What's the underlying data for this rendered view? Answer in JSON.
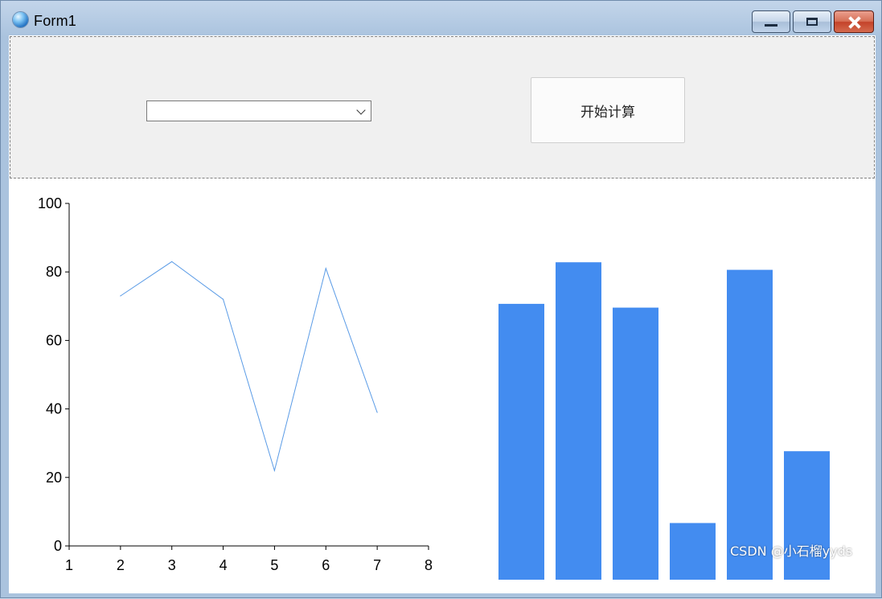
{
  "window": {
    "title": "Form1"
  },
  "controls": {
    "combo_value": "",
    "start_button_label": "开始计算"
  },
  "colors": {
    "accent": "#438cf0",
    "line": "#5a9be6"
  },
  "chart_data": [
    {
      "type": "line",
      "x": [
        2,
        3,
        4,
        5,
        6,
        7
      ],
      "y": [
        73,
        83,
        72,
        22,
        81,
        39
      ],
      "xlim": [
        1,
        8
      ],
      "ylim": [
        0,
        100
      ],
      "xticks": [
        1,
        2,
        3,
        4,
        5,
        6,
        7,
        8
      ],
      "yticks": [
        0,
        20,
        40,
        60,
        80,
        100
      ],
      "title": "",
      "xlabel": "",
      "ylabel": ""
    },
    {
      "type": "bar",
      "values": [
        73,
        84,
        72,
        15,
        82,
        34
      ],
      "ylim": [
        0,
        100
      ],
      "axes_visible": false,
      "title": ""
    }
  ],
  "watermark": "CSDN @小石榴yyds"
}
